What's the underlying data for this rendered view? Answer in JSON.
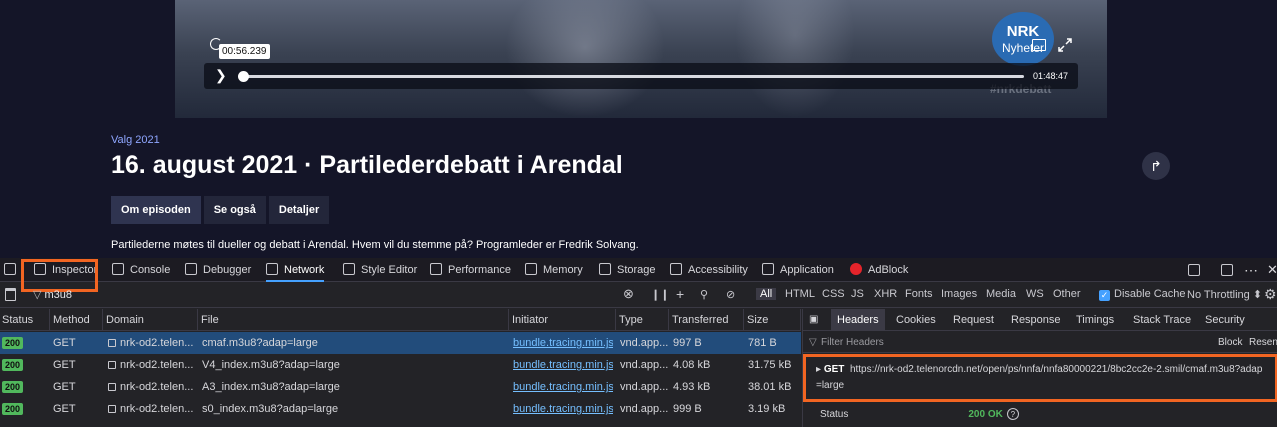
{
  "player": {
    "time_tooltip": "00:56.239",
    "duration": "01:48:47",
    "logo_line1": "NRK",
    "logo_line2": "Nyheter",
    "hashtag": "#nrkdebatt",
    "progress_fraction": 0.007
  },
  "program": {
    "category": "Valg 2021",
    "title": "16. august 2021 · Partilederdebatt i Arendal",
    "tabs": [
      "Om episoden",
      "Se også",
      "Detaljer"
    ],
    "description": "Partilederne møtes til dueller og debatt i Arendal. Hvem vil du stemme på? Programleder er Fredrik Solvang."
  },
  "devtools": {
    "tabs": [
      "Inspector",
      "Console",
      "Debugger",
      "Network",
      "Style Editor",
      "Performance",
      "Memory",
      "Storage",
      "Accessibility",
      "Application",
      "AdBlock"
    ],
    "active_tab": "Network",
    "filter_value": "m3u8",
    "type_filters": [
      "All",
      "HTML",
      "CSS",
      "JS",
      "XHR",
      "Fonts",
      "Images",
      "Media",
      "WS",
      "Other"
    ],
    "disable_cache": "Disable Cache",
    "throttling": "No Throttling ⬍",
    "columns": [
      "Status",
      "Method",
      "Domain",
      "File",
      "Initiator",
      "Type",
      "Transferred",
      "Size"
    ],
    "rows": [
      {
        "status": "200",
        "method": "GET",
        "domain": "nrk-od2.telen...",
        "file": "cmaf.m3u8?adap=large",
        "initiator": "bundle.tracing.min.js...",
        "type": "vnd.app...",
        "transferred": "997 B",
        "size": "781 B"
      },
      {
        "status": "200",
        "method": "GET",
        "domain": "nrk-od2.telen...",
        "file": "V4_index.m3u8?adap=large",
        "initiator": "bundle.tracing.min.js...",
        "type": "vnd.app...",
        "transferred": "4.08 kB",
        "size": "31.75 kB"
      },
      {
        "status": "200",
        "method": "GET",
        "domain": "nrk-od2.telen...",
        "file": "A3_index.m3u8?adap=large",
        "initiator": "bundle.tracing.min.js...",
        "type": "vnd.app...",
        "transferred": "4.93 kB",
        "size": "38.01 kB"
      },
      {
        "status": "200",
        "method": "GET",
        "domain": "nrk-od2.telen...",
        "file": "s0_index.m3u8?adap=large",
        "initiator": "bundle.tracing.min.js...",
        "type": "vnd.app...",
        "transferred": "999 B",
        "size": "3.19 kB"
      }
    ],
    "side_tabs": [
      "Headers",
      "Cookies",
      "Request",
      "Response",
      "Timings",
      "Stack Trace",
      "Security"
    ],
    "filter_headers": "Filter Headers",
    "block": "Block",
    "resend": "Resend",
    "get_method": "GET",
    "get_url": "https://nrk-od2.telenorcdn.net/open/ps/nnfa/nnfa80000221/8bc2cc2e-2.smil/cmaf.m3u8?adap=large",
    "status_label": "Status",
    "status_value": "200 OK"
  }
}
